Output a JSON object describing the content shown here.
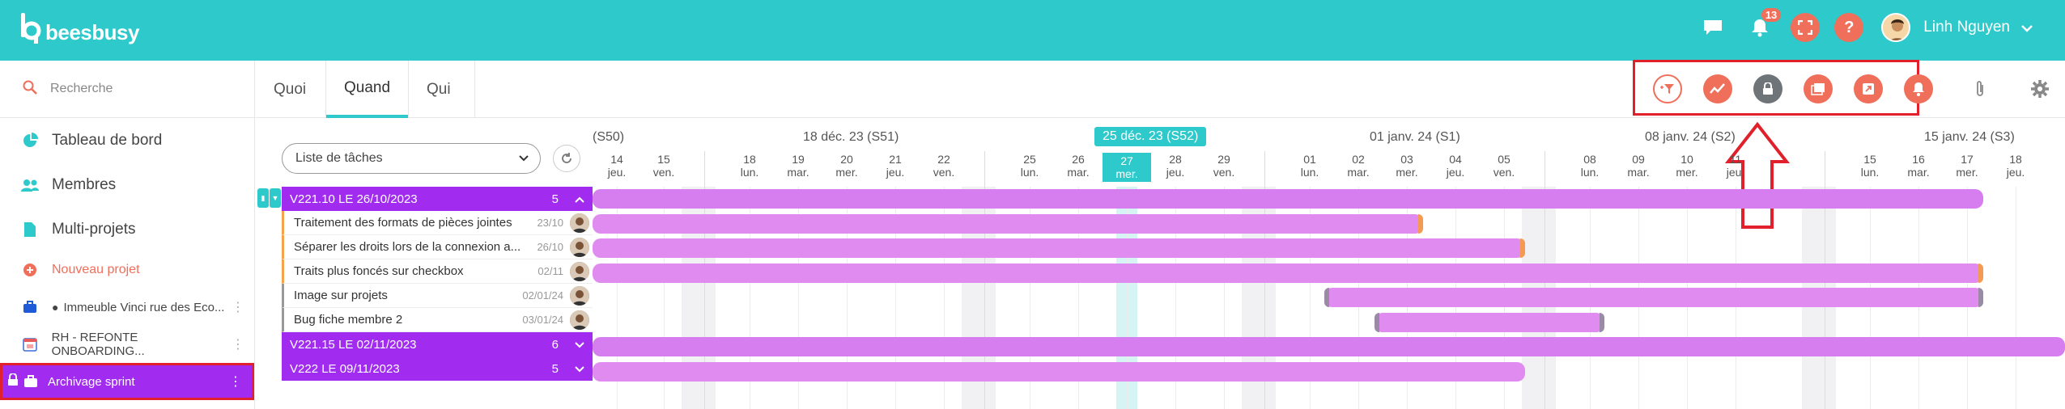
{
  "app": {
    "logo_text": "beesbusy"
  },
  "topbar": {
    "notification_count": "13",
    "username": "Linh Nguyen",
    "accent": "#2ec9cb",
    "red": "#f06f5b"
  },
  "sidebar": {
    "search_placeholder": "Recherche",
    "items": [
      {
        "label": "Tableau de bord",
        "icon": "pie-chart-icon"
      },
      {
        "label": "Membres",
        "icon": "users-icon"
      },
      {
        "label": "Multi-projets",
        "icon": "document-icon"
      },
      {
        "label": "Nouveau projet",
        "icon": "plus-icon"
      },
      {
        "label": "Immeuble Vinci rue des Eco...",
        "icon": "briefcase-icon"
      },
      {
        "label": "RH - REFONTE ONBOARDING...",
        "icon": "calendar-icon"
      },
      {
        "label": "Archivage sprint",
        "icon": "briefcase-icon"
      }
    ]
  },
  "tabs": [
    {
      "label": "Quoi"
    },
    {
      "label": "Quand"
    },
    {
      "label": "Qui"
    }
  ],
  "toolbar": {
    "buttons": [
      "filter-icon",
      "chart-icon",
      "lock-icon",
      "gallery-icon",
      "export-icon",
      "bell-icon",
      "paperclip-icon",
      "gear-icon"
    ]
  },
  "gantt": {
    "view_select": "Liste de tâches",
    "weeks": [
      {
        "label": "(S50)"
      },
      {
        "label": "18 déc. 23 (S51)"
      },
      {
        "label": "25 déc. 23 (S52)"
      },
      {
        "label": "01 janv. 24 (S1)"
      },
      {
        "label": "08 janv. 24 (S2)"
      },
      {
        "label": "15 janv. 24 (S3)"
      }
    ],
    "days": [
      {
        "n": "14",
        "d": "jeu."
      },
      {
        "n": "15",
        "d": "ven."
      },
      {
        "n": "18",
        "d": "lun."
      },
      {
        "n": "19",
        "d": "mar."
      },
      {
        "n": "20",
        "d": "mer."
      },
      {
        "n": "21",
        "d": "jeu."
      },
      {
        "n": "22",
        "d": "ven."
      },
      {
        "n": "25",
        "d": "lun."
      },
      {
        "n": "26",
        "d": "mar."
      },
      {
        "n": "27",
        "d": "mer."
      },
      {
        "n": "28",
        "d": "jeu."
      },
      {
        "n": "29",
        "d": "ven."
      },
      {
        "n": "01",
        "d": "lun."
      },
      {
        "n": "02",
        "d": "mar."
      },
      {
        "n": "03",
        "d": "mer."
      },
      {
        "n": "04",
        "d": "jeu."
      },
      {
        "n": "05",
        "d": "ven."
      },
      {
        "n": "08",
        "d": "lun."
      },
      {
        "n": "09",
        "d": "mar."
      },
      {
        "n": "10",
        "d": "mer."
      },
      {
        "n": "11",
        "d": "jeu."
      },
      {
        "n": "15",
        "d": "lun."
      },
      {
        "n": "16",
        "d": "mar."
      },
      {
        "n": "17",
        "d": "mer."
      },
      {
        "n": "18",
        "d": "jeu."
      }
    ],
    "rows": [
      {
        "type": "group",
        "label": "V221.10 LE 26/10/2023",
        "count": "5",
        "chevron": "up"
      },
      {
        "type": "task",
        "label": "Traitement des formats de pièces jointes",
        "date": "23/10",
        "status": "orange"
      },
      {
        "type": "task",
        "label": "Séparer les droits lors de la connexion a...",
        "date": "26/10",
        "status": "orange"
      },
      {
        "type": "task",
        "label": "Traits plus foncés sur checkbox",
        "date": "02/11",
        "status": "orange"
      },
      {
        "type": "task",
        "label": "Image sur projets",
        "date": "02/01/24",
        "status": "grey"
      },
      {
        "type": "task",
        "label": "Bug fiche membre 2",
        "date": "03/01/24",
        "status": "grey"
      },
      {
        "type": "group",
        "label": "V221.15 LE 02/11/2023",
        "count": "6",
        "chevron": "down"
      },
      {
        "type": "group",
        "label": "V222 LE 09/11/2023",
        "count": "5",
        "chevron": "down"
      }
    ]
  }
}
